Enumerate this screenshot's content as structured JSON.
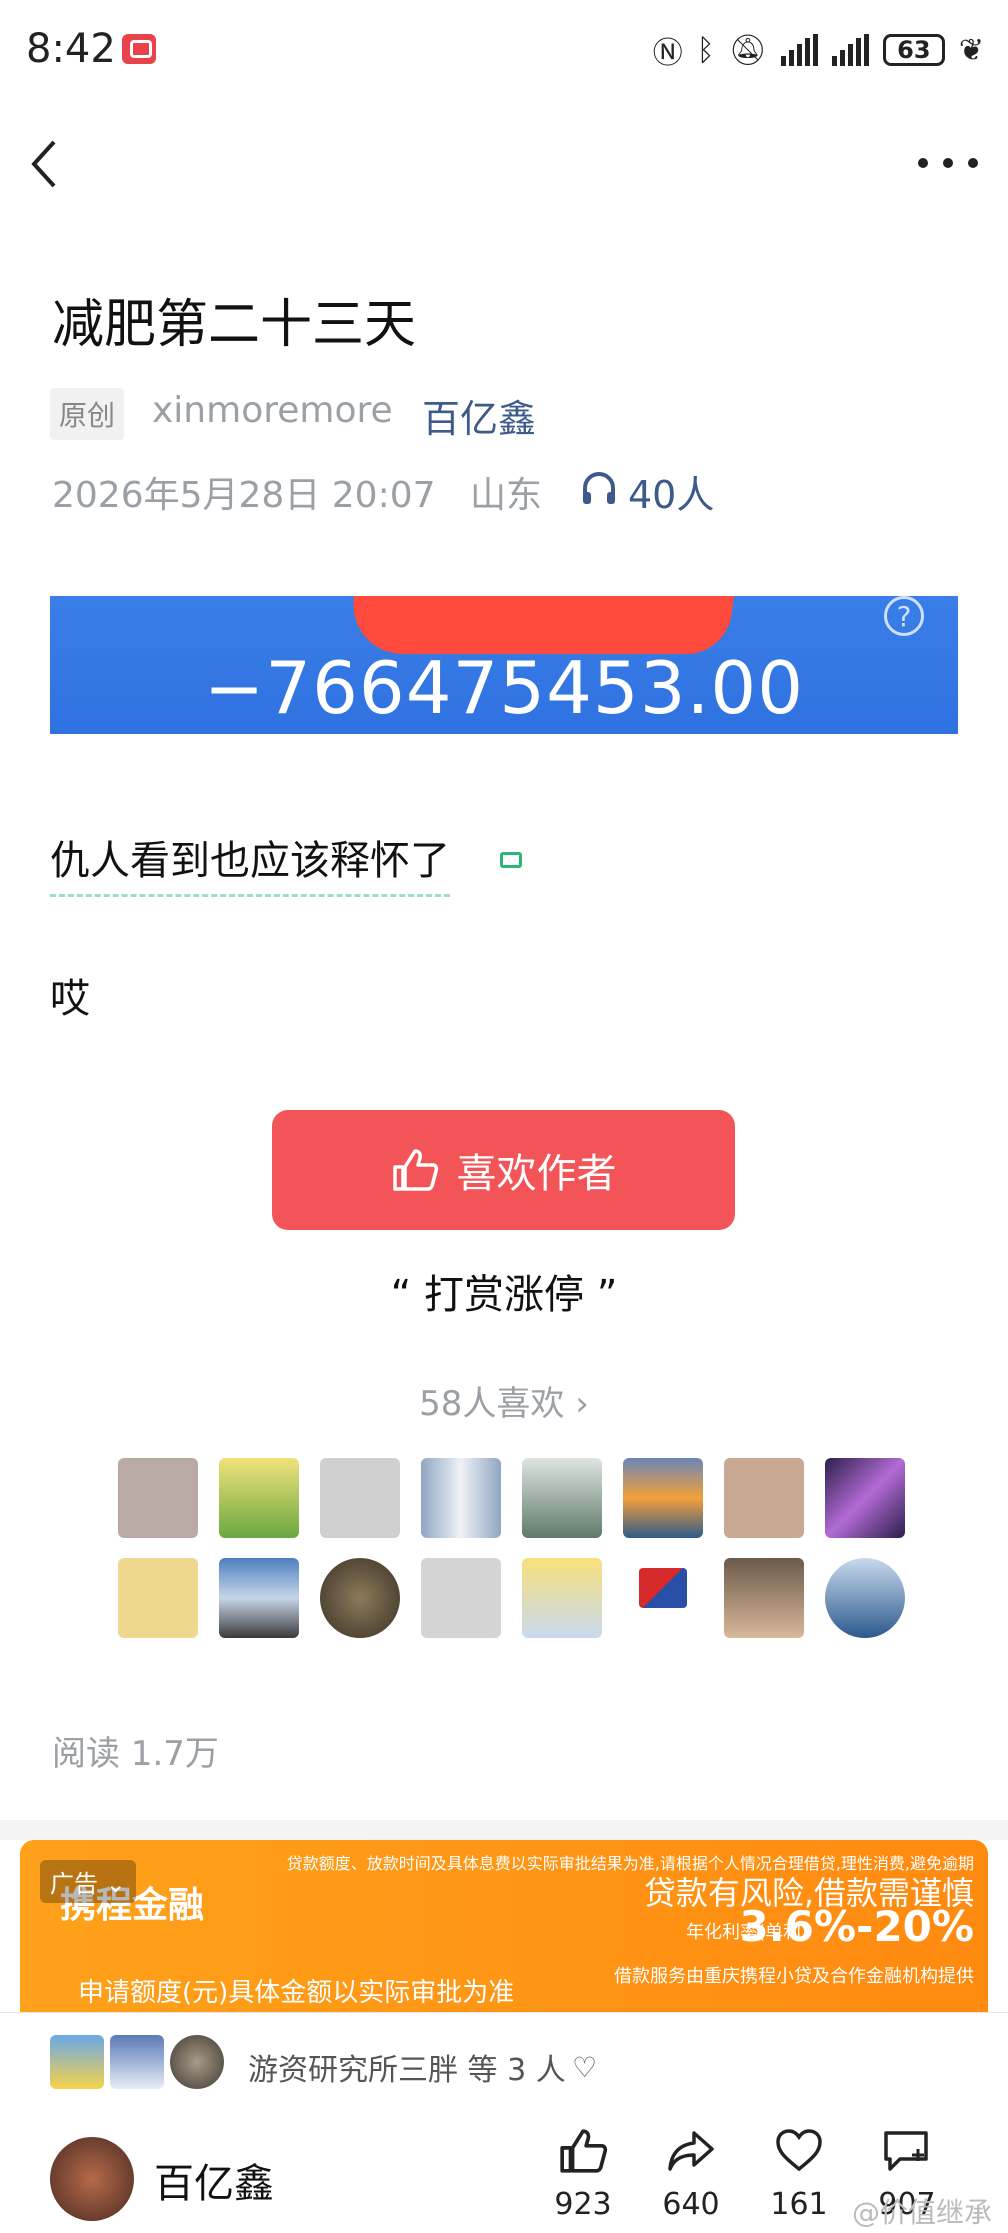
{
  "status_bar": {
    "time": "8:42",
    "battery": "63",
    "icons": [
      "nfc-icon",
      "bluetooth-icon",
      "mute-icon",
      "signal-icon",
      "signal-icon",
      "battery-icon",
      "leaf-icon"
    ]
  },
  "nav": {
    "back_icon": "back-icon",
    "more_icon": "more-icon"
  },
  "post": {
    "title": "减肥第二十三天",
    "badge": "原创",
    "author_handle": "xinmoremore",
    "author_name": "百亿鑫",
    "date": "2026年5月28日 20:07",
    "region": "山东",
    "listeners": "40人",
    "balance": "−766475453.00",
    "balance_help": "?",
    "line1": "仇人看到也应该释怀了",
    "line2": "哎",
    "like_author_label": "喜欢作者",
    "reward_text": "“  打赏涨停  ”",
    "likes_count": "58人喜欢 ›",
    "reads": "阅读 1.7万"
  },
  "ad": {
    "tag": "广告 ⌄",
    "brand": "携程金融",
    "disclaimer": "贷款额度、放款时间及具体息费以实际审批结果为准,请根据个人情况合理借贷,理性消费,避免逾期",
    "risk": "贷款有风险,借款需谨慎",
    "rate_label": "年化利率(单利)",
    "rate": "3.6%-20%",
    "provider": "借款服务由重庆携程小贷及合作金融机构提供",
    "apply": "申请额度(元)具体金额以实际审批为准"
  },
  "bottom": {
    "liker_text": "游资研究所三胖 等 3 人",
    "user_name": "百亿鑫",
    "likes": "923",
    "shares": "640",
    "favorites": "161",
    "comments": "907",
    "watermark": "@价值继承"
  },
  "colors": {
    "accent": "#f25457",
    "link": "#3d5a8a",
    "balance_bg": "#3a7ee8",
    "ad_bg": "#ffa11a"
  }
}
